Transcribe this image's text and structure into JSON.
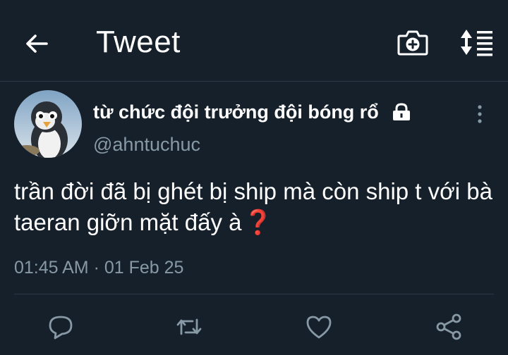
{
  "header": {
    "title": "Tweet",
    "back_icon": "arrow-left-icon",
    "camera_icon": "camera-plus-icon",
    "sort_icon": "sort-list-icon"
  },
  "tweet": {
    "display_name": "từ chức đội trưởng đội bóng rổ",
    "handle": "@ahntuchuc",
    "protected_icon": "lock-icon",
    "text": "trần đời đã bị ghét bị ship mà còn ship t với bà taeran giỡn mặt đấy à",
    "emoji": "❓",
    "timestamp": "01:45 AM · 01 Feb 25"
  },
  "actions": [
    {
      "name": "reply",
      "icon": "reply-icon"
    },
    {
      "name": "retweet",
      "icon": "retweet-icon"
    },
    {
      "name": "like",
      "icon": "heart-icon"
    },
    {
      "name": "share",
      "icon": "share-icon"
    }
  ],
  "colors": {
    "background": "#15202b",
    "text": "#ffffff",
    "muted": "#8899a6",
    "divider": "#2a3744",
    "emoji_red": "#e0263a"
  }
}
